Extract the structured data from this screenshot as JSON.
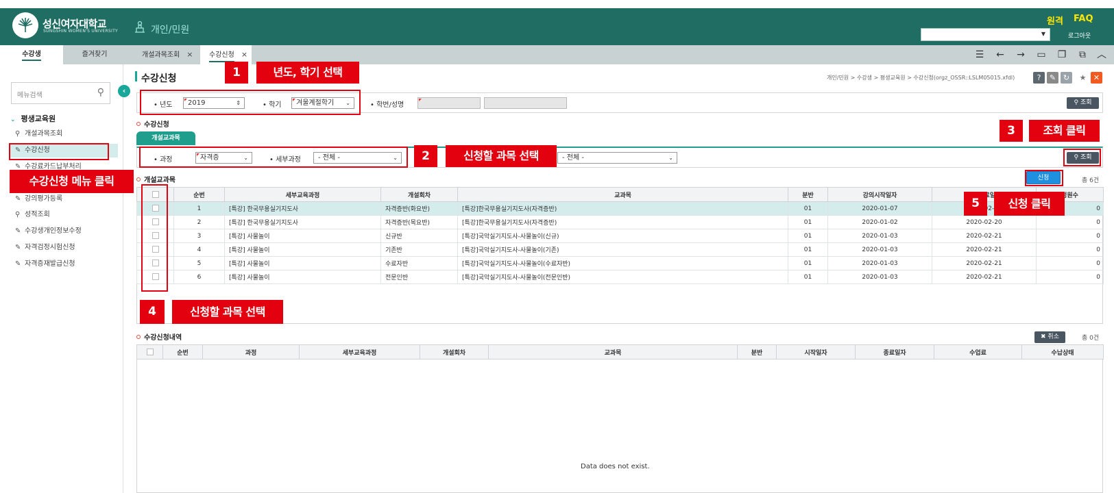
{
  "header": {
    "logo_name": "성신여자대학교",
    "logo_sub": "SUNGSHIN WOMEN'S UNIVERSITY",
    "menu_title": "개인/민원",
    "link_remote": "원격",
    "link_faq": "FAQ",
    "logout": "로그아웃"
  },
  "left_tabs": [
    "수강생",
    "즐겨찾기"
  ],
  "page_tabs": [
    {
      "label": "개설과목조회",
      "close": "×"
    },
    {
      "label": "수강신청",
      "close": "×"
    }
  ],
  "sidebar": {
    "search_placeholder": "메뉴검색",
    "group": "평생교육원",
    "items": [
      {
        "label": "개설과목조회",
        "icon": "search-icon"
      },
      {
        "label": "수강신청",
        "icon": "edit-icon"
      },
      {
        "label": "수강료카드납부처리",
        "icon": "edit-icon"
      },
      {
        "label": "강의평가등록",
        "icon": "edit-icon"
      },
      {
        "label": "성적조회",
        "icon": "search-icon"
      },
      {
        "label": "수강생개인정보수정",
        "icon": "edit-icon"
      },
      {
        "label": "자격검정시험신청",
        "icon": "edit-icon"
      },
      {
        "label": "자격증재발급신청",
        "icon": "edit-icon"
      }
    ]
  },
  "page": {
    "title": "수강신청",
    "breadcrumb": "개인/민원 > 수강생 > 평생교육원 > 수강신청(orgz_OSSR::LSLM05015.xfdl)"
  },
  "search": {
    "year_label": "년도",
    "year_value": "2019",
    "term_label": "학기",
    "term_value": "겨울계절학기",
    "student_label": "학번/성명",
    "search_button": "조회"
  },
  "apply_section": {
    "title": "수강신청",
    "tab": "개설교과목",
    "course_label": "과정",
    "course_value": "자격증",
    "detail_label": "세부과정",
    "detail_value": "- 전체 -",
    "extra_value": "- 전체 -",
    "search_button": "조회"
  },
  "courses": {
    "title": "개설교과목",
    "apply_button": "신청",
    "total": "총 6건",
    "columns": [
      "순번",
      "세부교육과정",
      "개설회차",
      "교과목",
      "분반",
      "강의시작일자",
      "강의종료일자",
      "정원수"
    ],
    "rows": [
      {
        "no": "1",
        "detail": "[특강] 한국무용실기지도사",
        "session": "자격증반(화요반)",
        "subject": "[특강]한국무용실기지도사(자격증반)",
        "section": "01",
        "start": "2020-01-07",
        "end": "2020-02-25",
        "cap": "0"
      },
      {
        "no": "2",
        "detail": "[특강] 한국무용실기지도사",
        "session": "자격증반(목요반)",
        "subject": "[특강]한국무용실기지도사(자격증반)",
        "section": "01",
        "start": "2020-01-02",
        "end": "2020-02-20",
        "cap": "0"
      },
      {
        "no": "3",
        "detail": "[특강] 사물놀이",
        "session": "신규반",
        "subject": "[특강]국악실기지도사-사물놀이(신규)",
        "section": "01",
        "start": "2020-01-03",
        "end": "2020-02-21",
        "cap": "0"
      },
      {
        "no": "4",
        "detail": "[특강] 사물놀이",
        "session": "기존반",
        "subject": "[특강]국악실기지도사-사물놀이(기존)",
        "section": "01",
        "start": "2020-01-03",
        "end": "2020-02-21",
        "cap": "0"
      },
      {
        "no": "5",
        "detail": "[특강] 사물놀이",
        "session": "수료자반",
        "subject": "[특강]국악실기지도사-사물놀이(수료자반)",
        "section": "01",
        "start": "2020-01-03",
        "end": "2020-02-21",
        "cap": "0"
      },
      {
        "no": "6",
        "detail": "[특강] 사물놀이",
        "session": "전문인반",
        "subject": "[특강]국악실기지도사-사물놀이(전문인반)",
        "section": "01",
        "start": "2020-01-03",
        "end": "2020-02-21",
        "cap": "0"
      }
    ]
  },
  "history": {
    "title": "수강신청내역",
    "cancel_button": "취소",
    "total": "총 0건",
    "columns": [
      "순번",
      "과정",
      "세부교육과정",
      "개설회차",
      "교과목",
      "분반",
      "시작일자",
      "종료일자",
      "수업료",
      "수납상태"
    ],
    "empty": "Data does not exist."
  },
  "annotations": [
    {
      "num": "1",
      "label": "년도, 학기 선택"
    },
    {
      "num": "2",
      "label": "신청할 과목 선택"
    },
    {
      "num": "3",
      "label": "조회 클릭"
    },
    {
      "num": "4",
      "label": "신청할 과목 선택"
    },
    {
      "num": "5",
      "label": "신청 클릭"
    },
    {
      "num": "",
      "label": "수강신청 메뉴 클릭"
    }
  ],
  "colors": {
    "header": "#1f6d63",
    "accent": "#1f9e8d",
    "annotation": "#e3000f",
    "apply": "#1f8fe0"
  }
}
